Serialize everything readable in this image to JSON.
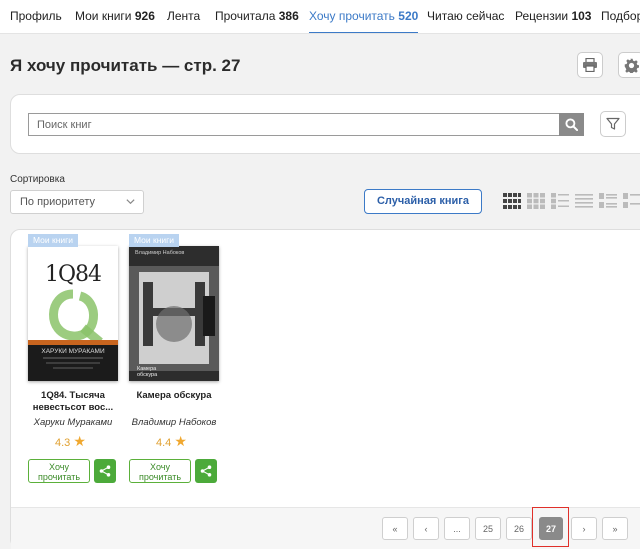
{
  "nav": {
    "items": [
      {
        "label": "Профиль",
        "count": ""
      },
      {
        "label": "Мои книги",
        "count": "926"
      },
      {
        "label": "Лента",
        "count": ""
      },
      {
        "label": "Прочитала",
        "count": "386"
      },
      {
        "label": "Хочу прочитать",
        "count": "520"
      },
      {
        "label": "Читаю сейчас",
        "count": ""
      },
      {
        "label": "Рецензии",
        "count": "103"
      },
      {
        "label": "Подбор",
        "count": ""
      }
    ],
    "active_index": 4
  },
  "page": {
    "title": "Я хочу прочитать — стр. 27"
  },
  "search": {
    "placeholder": "Поиск книг",
    "value": ""
  },
  "sort": {
    "label": "Сортировка",
    "selected": "По приоритету",
    "random_button": "Случайная книга"
  },
  "books": [
    {
      "badge": "Мои книги",
      "title_line1": "1Q84. Тысяча",
      "title_line2": "невестьсот вос...",
      "author": "Харуки Мураками",
      "rating": "4.3",
      "cover_text": "1Q84",
      "cover_author": "ХАРУКИ МУРАКАМИ",
      "want_line1": "Хочу",
      "want_line2": "прочитать"
    },
    {
      "badge": "Мои книги",
      "title_line1": "Камера обскура",
      "title_line2": "",
      "author": "Владимир Набоков",
      "rating": "4.4",
      "cover_text": "Камера обскура",
      "cover_author": "Владимир Набоков",
      "want_line1": "Хочу",
      "want_line2": "прочитать"
    }
  ],
  "pagination": {
    "first": "«",
    "prev": "‹",
    "ellipsis": "...",
    "pages": [
      "25",
      "26",
      "27"
    ],
    "current": "27",
    "next": "›",
    "last": "»"
  },
  "colors": {
    "accent": "#3c7ac7",
    "green": "#4caa3a",
    "star": "#f0a830",
    "highlight": "#e0302a"
  }
}
